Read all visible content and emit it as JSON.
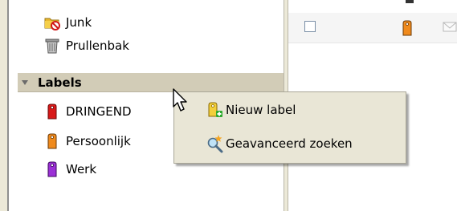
{
  "folders": [
    {
      "label": "Junk",
      "icon": "junk-folder-icon"
    },
    {
      "label": "Prullenbak",
      "icon": "trash-icon"
    }
  ],
  "labels_section": {
    "title": "Labels",
    "items": [
      {
        "label": "DRINGEND",
        "icon": "tag-red-icon",
        "color": "#d81818"
      },
      {
        "label": "Persoonlijk",
        "icon": "tag-orange-icon",
        "color": "#f08a1c"
      },
      {
        "label": "Werk",
        "icon": "tag-purple-icon",
        "color": "#9b30d6"
      }
    ]
  },
  "context_menu": {
    "items": [
      {
        "label": "Nieuw label",
        "icon": "new-label-icon"
      },
      {
        "label": "Geavanceerd zoeken",
        "icon": "advanced-search-icon"
      }
    ]
  },
  "message_list": {
    "row_tag_color": "#f08a1c"
  }
}
